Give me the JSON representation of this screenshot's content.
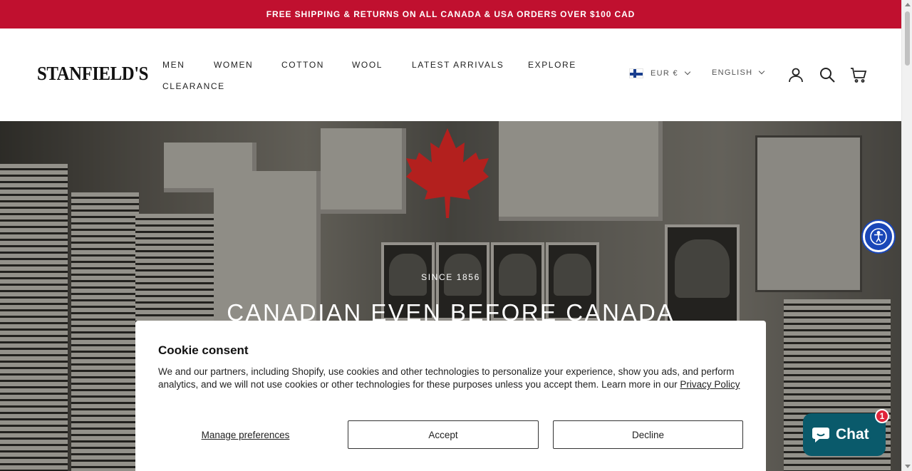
{
  "announcement": "FREE SHIPPING & RETURNS ON ALL CANADA & USA ORDERS OVER $100 CAD",
  "brand": {
    "name": "STANFIELD'S"
  },
  "nav": {
    "items": [
      {
        "label": "MEN"
      },
      {
        "label": "WOMEN"
      },
      {
        "label": "COTTON"
      },
      {
        "label": "WOOL"
      },
      {
        "label": "LATEST ARRIVALS"
      },
      {
        "label": "EXPLORE"
      },
      {
        "label": "CLEARANCE"
      }
    ]
  },
  "header_utils": {
    "currency": "EUR €",
    "language": "ENGLISH",
    "icons": [
      "account-icon",
      "search-icon",
      "cart-icon"
    ]
  },
  "hero": {
    "eyebrow": "SINCE 1856",
    "title": "CANADIAN EVEN BEFORE CANADA"
  },
  "cookie": {
    "title": "Cookie consent",
    "body": "We and our partners, including Shopify, use cookies and other technologies to personalize your experience, show you ads, and perform analytics, and we will not use cookies or other technologies for these purposes unless you accept them. Learn more in our",
    "privacy_link": "Privacy Policy",
    "manage_label": "Manage preferences",
    "accept_label": "Accept",
    "decline_label": "Decline"
  },
  "chat": {
    "label": "Chat",
    "badge": "1"
  },
  "colors": {
    "brand_red": "#c0102f",
    "chat_teal": "#0a5a6b",
    "a11y_blue": "#1a47b8"
  }
}
